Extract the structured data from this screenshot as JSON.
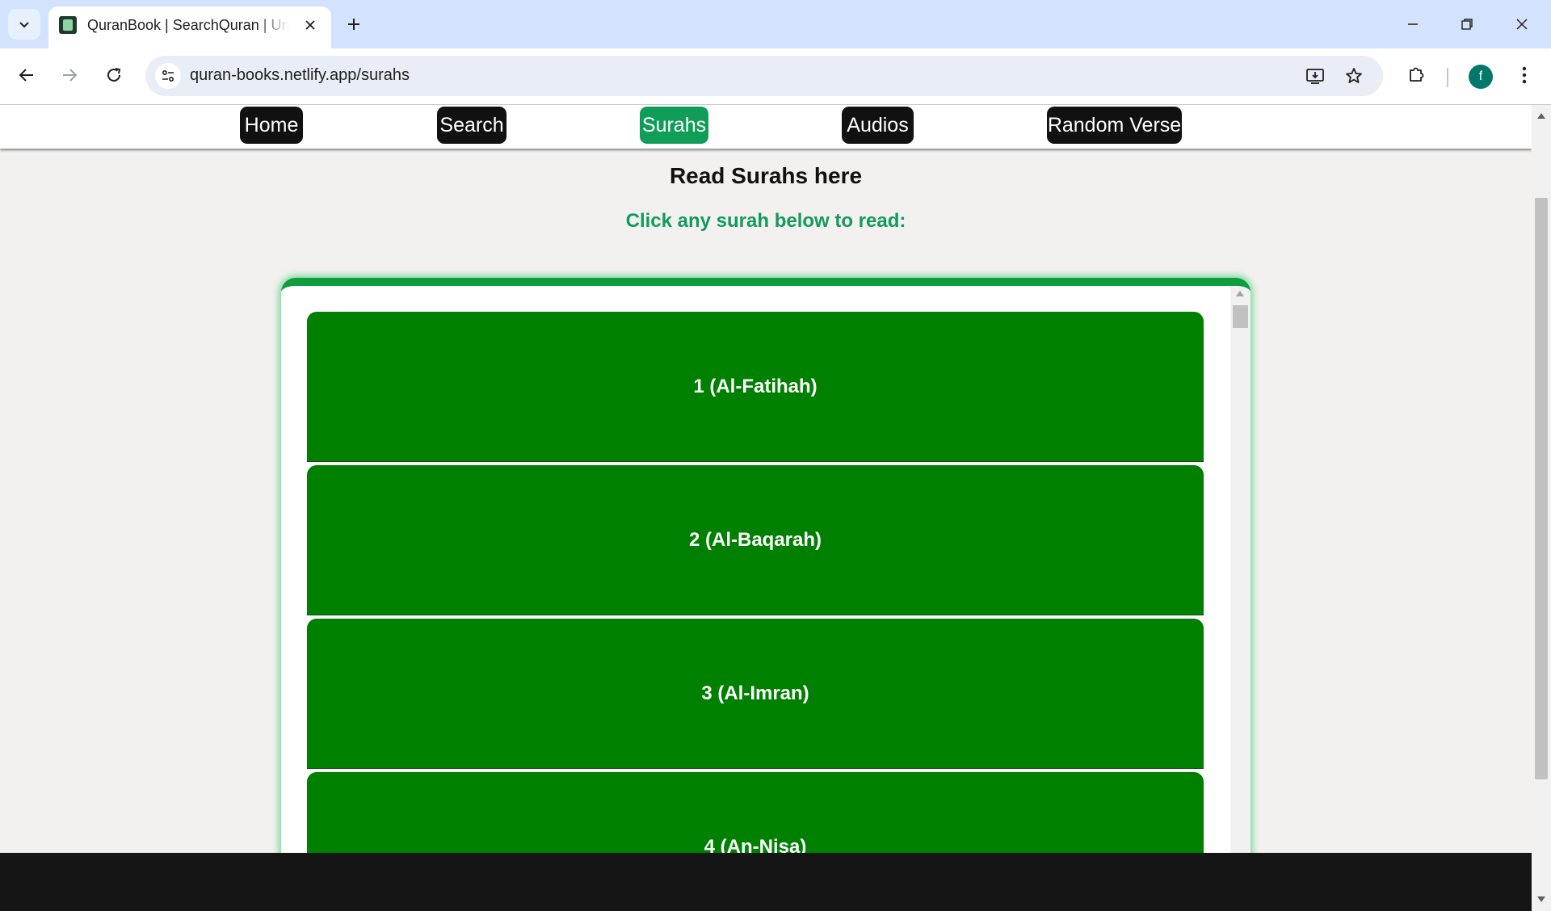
{
  "browser": {
    "tab_title": "QuranBook | SearchQuran | Understand",
    "url": "quran-books.netlify.app/surahs",
    "profile_initial": "f",
    "icons": {
      "tab_search": "chevron-down-icon",
      "close_tab": "close-icon",
      "new_tab": "plus-icon",
      "minimize": "minimize-icon",
      "restore": "restore-icon",
      "close_window": "close-icon",
      "back": "arrow-left-icon",
      "forward": "arrow-right-icon",
      "reload": "reload-icon",
      "site_info": "tune-icon",
      "install": "install-app-icon",
      "bookmark": "star-icon",
      "extensions": "puzzle-icon",
      "menu": "more-vert-icon"
    }
  },
  "site": {
    "nav": [
      {
        "label": "Home",
        "active": false
      },
      {
        "label": "Search",
        "active": false
      },
      {
        "label": "Surahs",
        "active": true
      },
      {
        "label": "Audios",
        "active": false
      },
      {
        "label": "Random Verse",
        "active": false
      }
    ],
    "heading": "Read Surahs here",
    "subheading": "Click any surah below to read:",
    "surahs": [
      {
        "label": "1 (Al-Fatihah)"
      },
      {
        "label": "2 (Al-Baqarah)"
      },
      {
        "label": "3 (Al-Imran)"
      },
      {
        "label": "4 (An-Nisa)"
      }
    ],
    "footer_links": [
      "github-icon",
      "facebook-icon",
      "linkedin-icon",
      "instagram-icon",
      "twitter-icon",
      "medium-icon"
    ]
  },
  "colors": {
    "nav_button": "#111111",
    "nav_active": "#0f9d58",
    "surah_button": "#008000",
    "subheading": "#129b5a",
    "footer": "#151515"
  }
}
